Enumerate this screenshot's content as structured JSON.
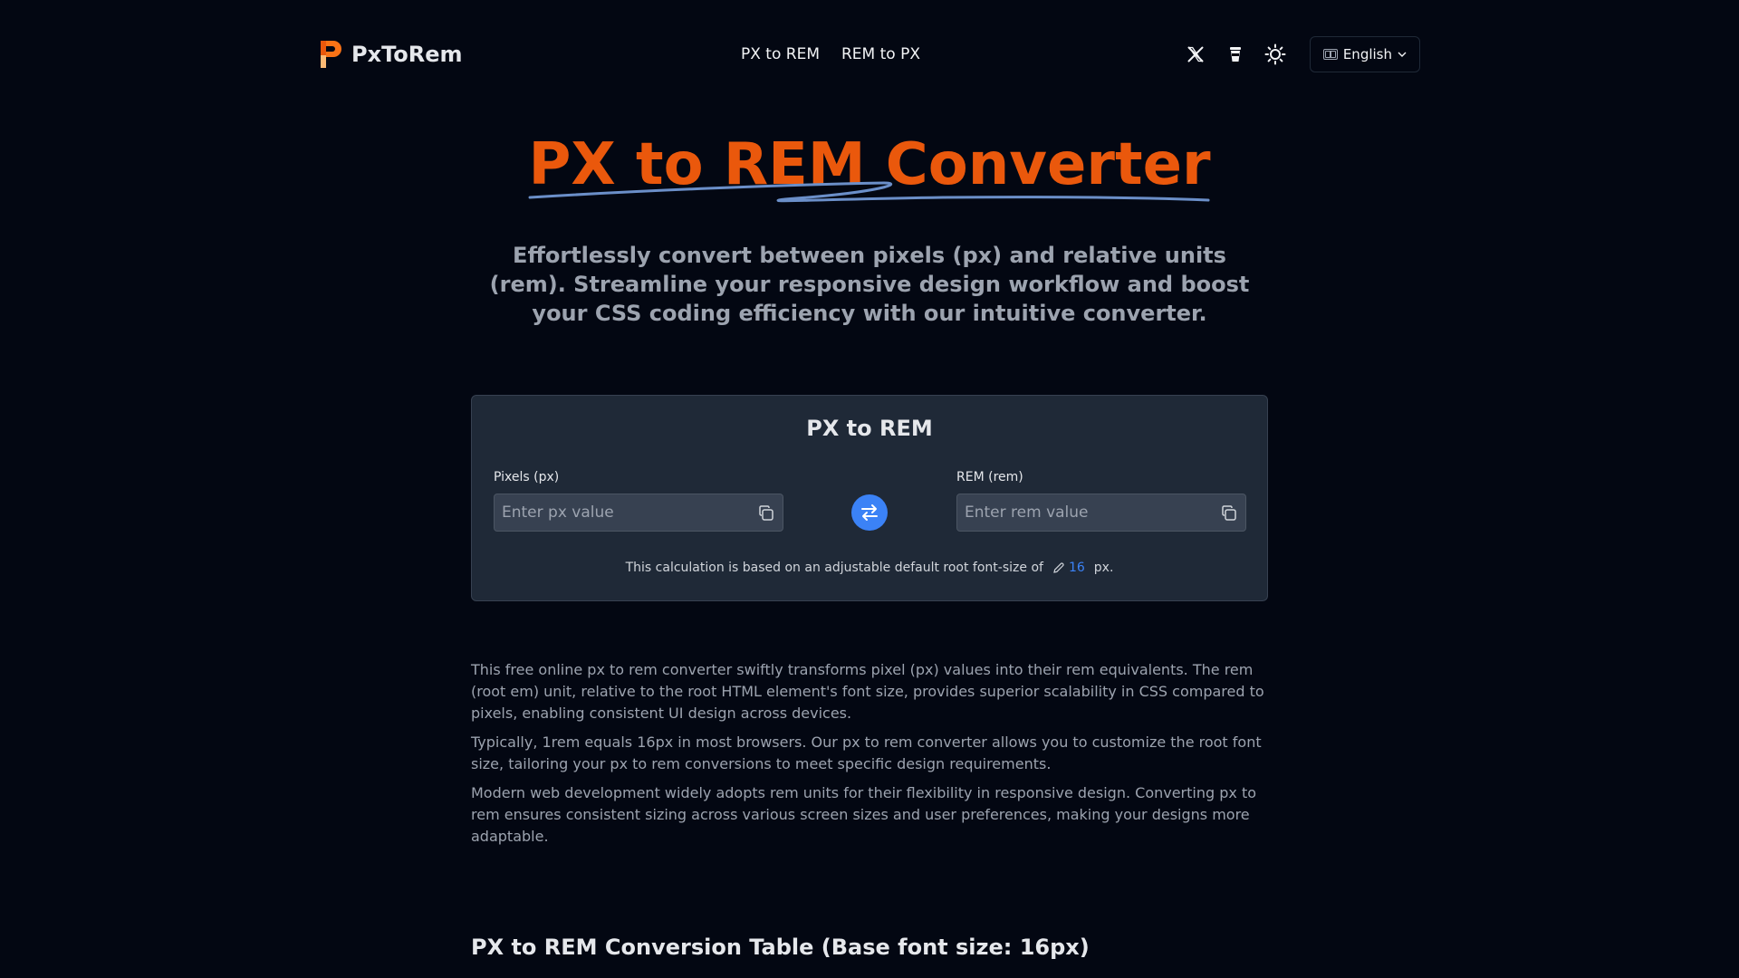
{
  "header": {
    "brand_name": "PxToRem",
    "nav": [
      {
        "label": "PX to REM"
      },
      {
        "label": "REM to PX"
      }
    ],
    "icons": [
      "x-twitter-icon",
      "coffee-cup-icon",
      "sun-icon"
    ],
    "language": "English"
  },
  "hero": {
    "title": "PX to REM Converter",
    "subtitle": "Effortlessly convert between pixels (px) and relative units (rem). Streamline your responsive design workflow and boost your CSS coding efficiency with our intuitive converter."
  },
  "converter": {
    "title": "PX to REM",
    "px_label": "Pixels (px)",
    "px_placeholder": "Enter px value",
    "px_value": "",
    "rem_label": "REM (rem)",
    "rem_placeholder": "Enter rem value",
    "rem_value": "",
    "note_prefix": "This calculation is based on an adjustable default root font-size of",
    "base_font_size": "16",
    "note_suffix": "px."
  },
  "description": [
    "This free online px to rem converter swiftly transforms pixel (px) values into their rem equivalents. The rem (root em) unit, relative to the root HTML element's font size, provides superior scalability in CSS compared to pixels, enabling consistent UI design across devices.",
    "Typically, 1rem equals 16px in most browsers. Our px to rem converter allows you to customize the root font size, tailoring your px to rem conversions to meet specific design requirements.",
    "Modern web development widely adopts rem units for their flexibility in responsive design. Converting px to rem ensures consistent sizing across various screen sizes and user preferences, making your designs more adaptable."
  ],
  "table": {
    "heading": "PX to REM Conversion Table (Base font size: 16px)"
  },
  "colors": {
    "background": "#030712",
    "accent": "#ea580c",
    "link": "#3b82f6",
    "card": "#1f2937"
  }
}
